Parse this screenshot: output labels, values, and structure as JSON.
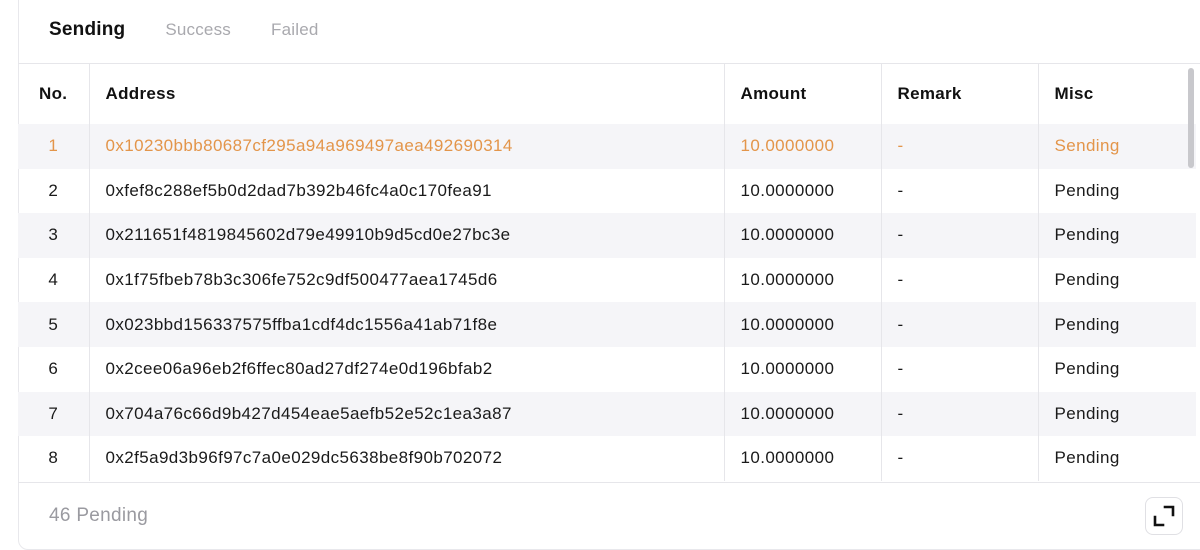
{
  "tabs": [
    {
      "label": "Sending",
      "active": true
    },
    {
      "label": "Success",
      "active": false
    },
    {
      "label": "Failed",
      "active": false
    }
  ],
  "table": {
    "headers": [
      "No.",
      "Address",
      "Amount",
      "Remark",
      "Misc"
    ],
    "rows": [
      {
        "no": "1",
        "address": "0x10230bbb80687cf295a94a969497aea492690314",
        "amount": "10.0000000",
        "remark": "-",
        "misc": "Sending"
      },
      {
        "no": "2",
        "address": "0xfef8c288ef5b0d2dad7b392b46fc4a0c170fea91",
        "amount": "10.0000000",
        "remark": "-",
        "misc": "Pending"
      },
      {
        "no": "3",
        "address": "0x211651f4819845602d79e49910b9d5cd0e27bc3e",
        "amount": "10.0000000",
        "remark": "-",
        "misc": "Pending"
      },
      {
        "no": "4",
        "address": "0x1f75fbeb78b3c306fe752c9df500477aea1745d6",
        "amount": "10.0000000",
        "remark": "-",
        "misc": "Pending"
      },
      {
        "no": "5",
        "address": "0x023bbd156337575ffba1cdf4dc1556a41ab71f8e",
        "amount": "10.0000000",
        "remark": "-",
        "misc": "Pending"
      },
      {
        "no": "6",
        "address": "0x2cee06a96eb2f6ffec80ad27df274e0d196bfab2",
        "amount": "10.0000000",
        "remark": "-",
        "misc": "Pending"
      },
      {
        "no": "7",
        "address": "0x704a76c66d9b427d454eae5aefb52e52c1ea3a87",
        "amount": "10.0000000",
        "remark": "-",
        "misc": "Pending"
      },
      {
        "no": "8",
        "address": "0x2f5a9d3b96f97c7a0e029dc5638be8f90b702072",
        "amount": "10.0000000",
        "remark": "-",
        "misc": "Pending"
      }
    ]
  },
  "footer": {
    "status": "46 Pending",
    "expand_icon": "expand-icon"
  },
  "colors": {
    "active_row_text": "#e3954a",
    "stripe": "#f5f5f8",
    "inactive_tab": "#a9a9ae"
  }
}
